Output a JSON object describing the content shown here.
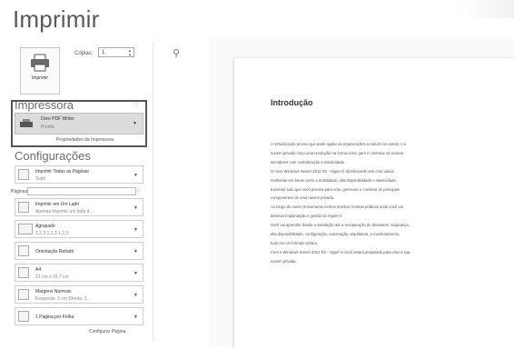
{
  "title": "Imprimir",
  "print_button": {
    "label": "Imprimir"
  },
  "copies": {
    "label": "Cópias:",
    "value": "1"
  },
  "printer": {
    "header": "Impressora",
    "name": "Doro PDF Writer",
    "status": "Pronto",
    "properties_link": "Propriedades da Impressora",
    "info_icon": "ⓘ"
  },
  "settings": {
    "header": "Configurações",
    "pages_label": "Páginas:",
    "pages_value": "",
    "pages_info_icon": "ⓘ",
    "options": [
      {
        "line1": "Imprimir Todas as Páginas",
        "line2": "Tudo"
      },
      {
        "line1": "Imprimir em Um Lado",
        "line2": "Apenas imprimir um lado d..."
      },
      {
        "line1": "Agrupado",
        "line2": "1,2,3   1,2,3   1,2,3"
      },
      {
        "line1": "Orientação Retrato",
        "line2": ""
      },
      {
        "line1": "A4",
        "line2": "21 cm x 29,7 cm"
      },
      {
        "line1": "Margens Normais",
        "line2": "Esquerda: 3 cm   Direita: 3..."
      },
      {
        "line1": "1 Página por Folha",
        "line2": ""
      }
    ],
    "page_setup_link": "Configurar Página"
  },
  "preview": {
    "heading": "Introdução",
    "paragraphs": [
      "A Virtualização provou que pode ajudar as organizações a reduzir os custos, e a",
      "nuvem privada criou uma revolução na forma como gerir e controlar os nossos",
      "servidores com centralização e elasticidade.",
      "O novo Windows Server 2012 R2 - Hyper-V da Microsoft vem com várias",
      "melhorias em áreas como a mobilidade, alta disponibilidade e elasticidade,",
      "trazendo tudo que você precisa para criar, gerenciar e construir os principais",
      "componentes de uma nuvem privada.",
      "Ao longo do nosso treinamento iremos mostrar receitas práticas onde você vai",
      "dominar implantação e gestão do Hyper-V.",
      "Você vai aprender desde a instalação até a recuperação de desastres, segurança,",
      "alta disponibilidade, configuração, automação, arquitetura, e monitoramento,",
      "tudo em um formato prático.",
      "Com o Windows Server 2012 R2 - Hyper-V você estará preparado para criar a sua",
      "nuvem privada."
    ]
  },
  "colors": {
    "box_border": "#555555",
    "selected_bg": "#dcdcdc"
  }
}
